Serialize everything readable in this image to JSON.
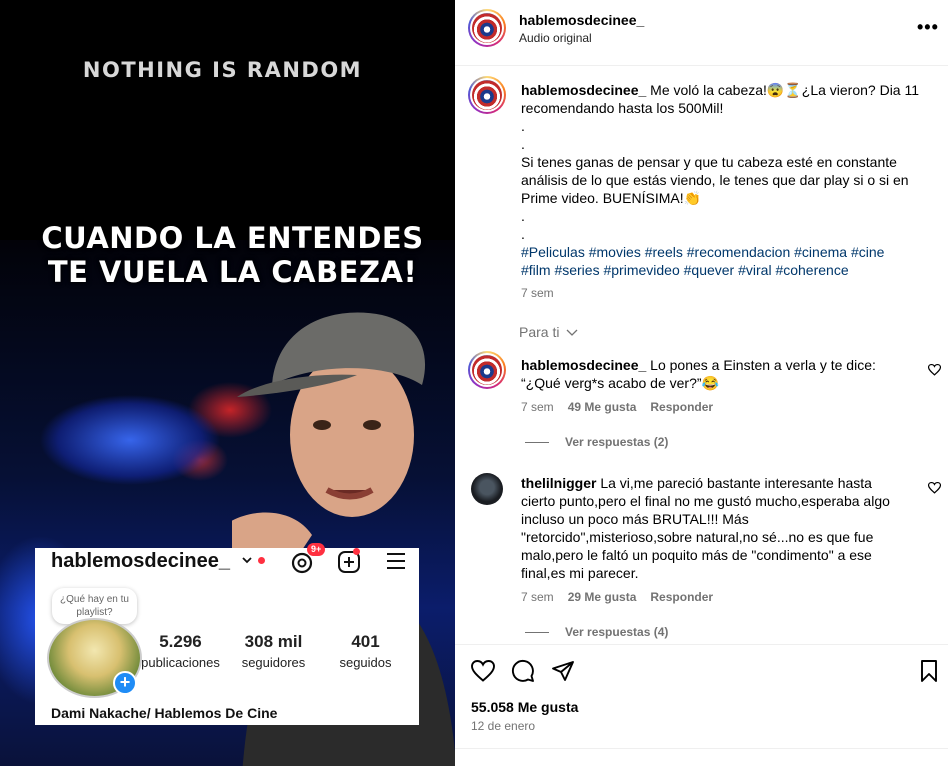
{
  "video": {
    "top_text": "NOTHING IS RANDOM",
    "caption_line1": "CUANDO LA ENTENDES",
    "caption_line2": "TE VUELA LA CABEZA!",
    "profile_card": {
      "username": "hablemosdecinee_",
      "threads_badge": "9+",
      "note_bubble": "¿Qué hay en tu playlist?",
      "stats": [
        {
          "value": "5.296",
          "label": "publicaciones"
        },
        {
          "value": "308 mil",
          "label": "seguidores"
        },
        {
          "value": "401",
          "label": "seguidos"
        }
      ],
      "full_name": "Dami Nakache/ Hablemos De Cine"
    }
  },
  "post": {
    "header": {
      "username": "hablemosdecinee_",
      "subtitle": "Audio original",
      "more": "•••"
    },
    "caption": {
      "username": "hablemosdecinee_",
      "line1": "Me voló la cabeza!😨⏳¿La vieron? Dia 11",
      "line2": "recomendando hasta los 500Mil!",
      "dot1": ".",
      "dot2": ".",
      "line3": "Si tenes ganas de pensar y que tu cabeza esté en constante",
      "line4": "análisis de lo que estás viendo, le tenes que dar play si o si en",
      "line5": "Prime video. BUENÍSIMA!👏",
      "dot3": ".",
      "dot4": ".",
      "tags1": "#Peliculas #movies #reels #recomendacion #cinema #cine",
      "tags2": "#film #series #primevideo #quever #viral #coherence",
      "time": "7 sem"
    },
    "section_label": "Para ti",
    "comments": [
      {
        "username": "hablemosdecinee_",
        "line1": "Lo pones a Einsten a verla y te dice:",
        "line2": "“¿Qué verg*s acabo de ver?”😂",
        "time": "7 sem",
        "likes": "49 Me gusta",
        "reply": "Responder",
        "view_replies": "Ver respuestas (2)"
      },
      {
        "username": "thelilnigger",
        "line1": "La vi,me pareció bastante interesante hasta",
        "line2": "cierto punto,pero el final no me gustó mucho,esperaba algo",
        "line3": "incluso un poco más BRUTAL!!! Más",
        "line4": "\"retorcido\",misterioso,sobre natural,no sé...no es que fue",
        "line5": "malo,pero le faltó un poquito más de \"condimento\" a ese",
        "line6": "final,es mi parecer.",
        "time": "7 sem",
        "likes": "29 Me gusta",
        "reply": "Responder",
        "view_replies": "Ver respuestas (4)"
      }
    ],
    "likes_total": "55.058 Me gusta",
    "date": "12 de enero"
  },
  "icons": [
    "heart-icon",
    "comment-icon",
    "share-icon",
    "bookmark-icon",
    "more-icon",
    "chevron-down-icon",
    "threads-icon",
    "plus-square-icon",
    "menu-icon"
  ]
}
